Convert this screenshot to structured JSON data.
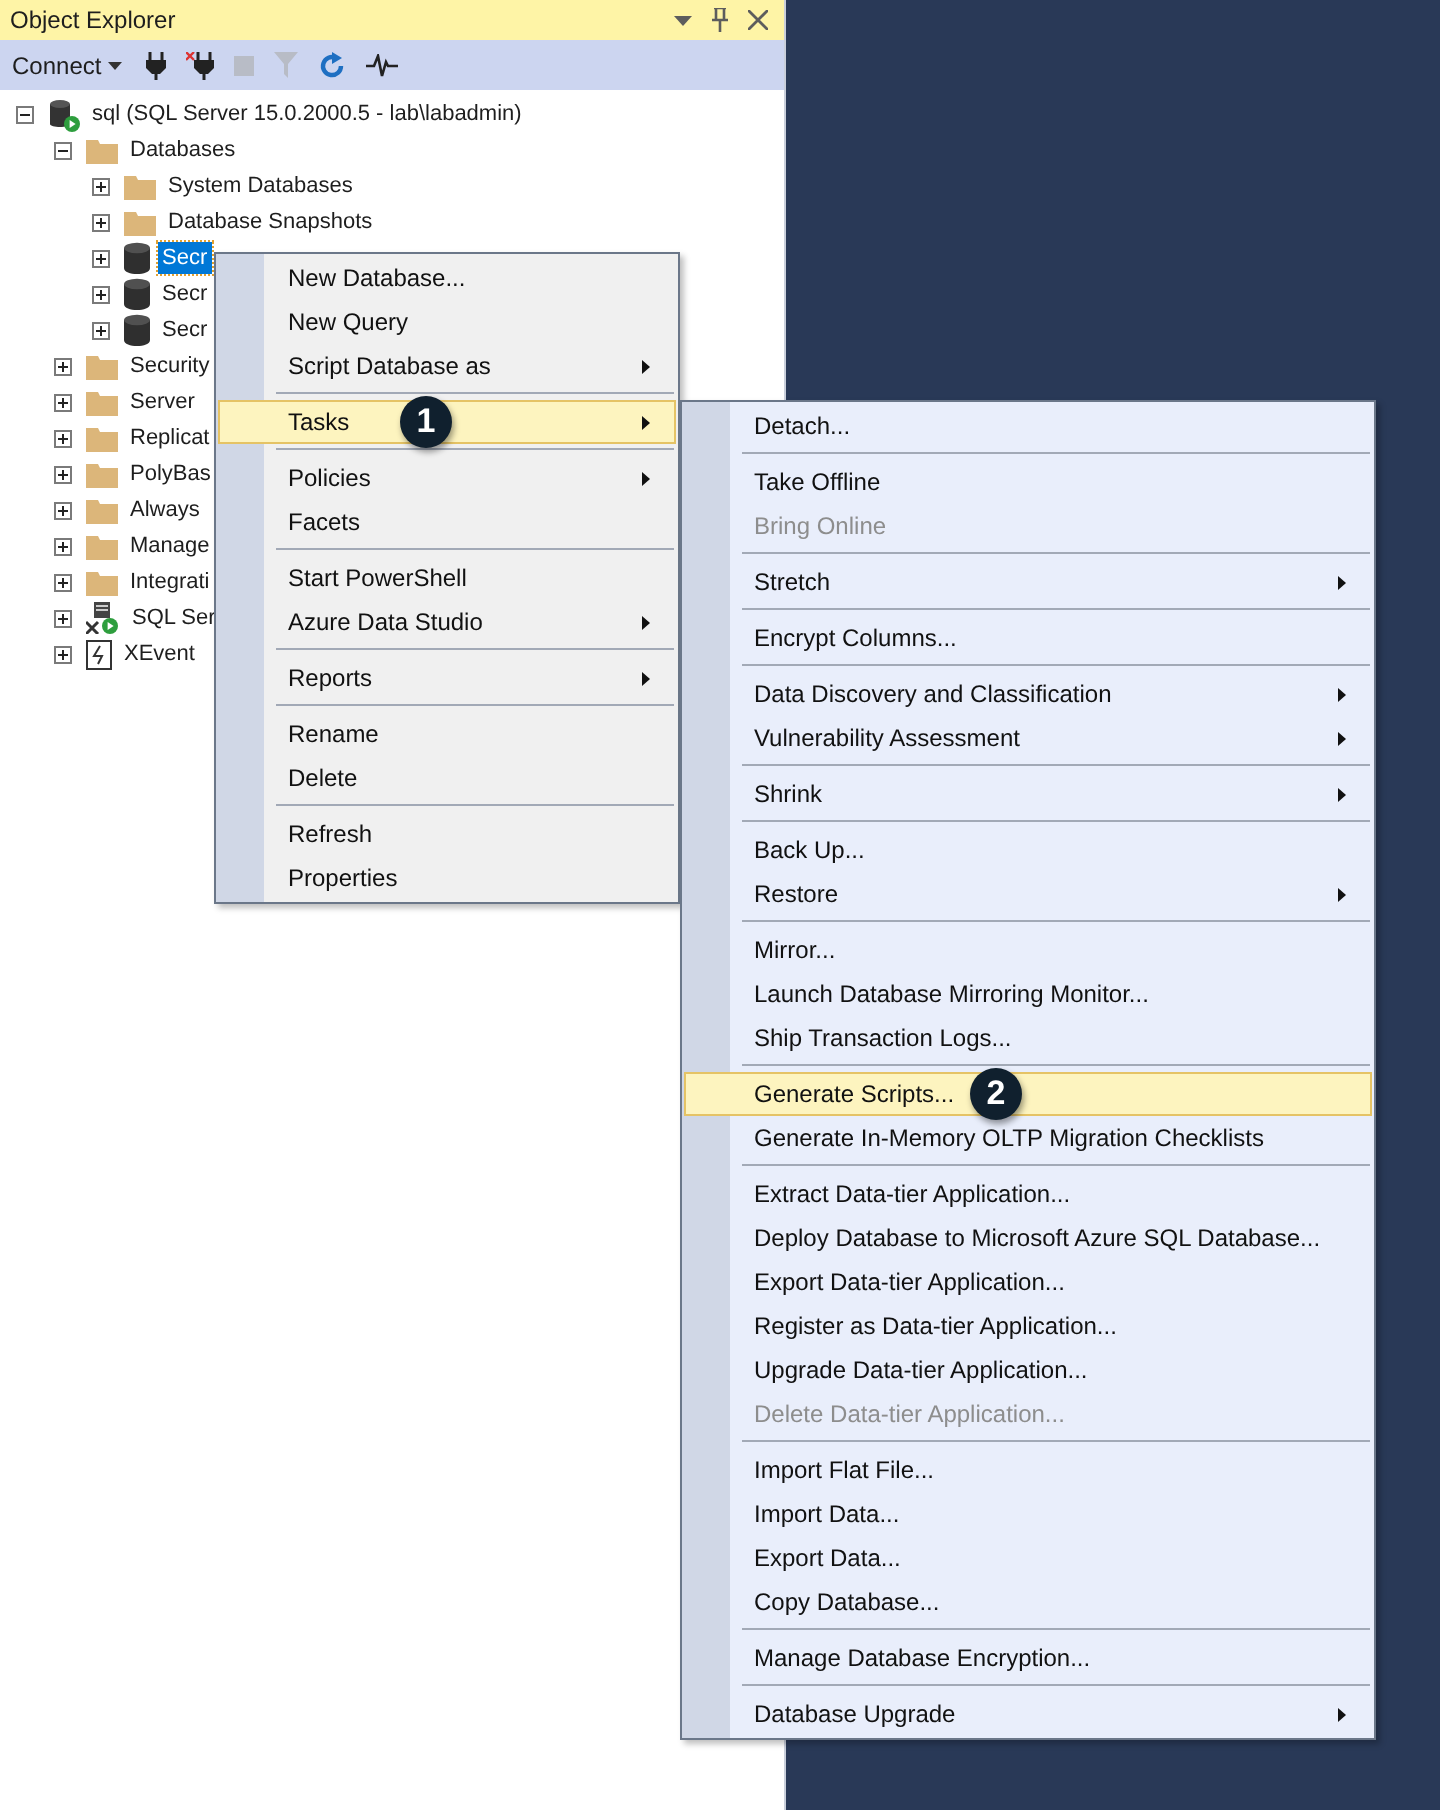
{
  "panel": {
    "title": "Object Explorer"
  },
  "toolbar": {
    "connect_label": "Connect"
  },
  "tree": [
    {
      "label": "sql (SQL Server 15.0.2000.5 - lab\\labadmin)",
      "kind": "server",
      "expanded": true,
      "selected": false,
      "children": [
        {
          "label": "Databases",
          "kind": "folder",
          "expanded": true,
          "selected": false,
          "children": [
            {
              "label": "System Databases",
              "kind": "folder",
              "expanded": false,
              "selected": false
            },
            {
              "label": "Database Snapshots",
              "kind": "folder",
              "expanded": false,
              "selected": false
            },
            {
              "label": "Secr",
              "kind": "database",
              "expanded": false,
              "selected": true
            },
            {
              "label": "Secr",
              "kind": "database",
              "expanded": false,
              "selected": false
            },
            {
              "label": "Secr",
              "kind": "database",
              "expanded": false,
              "selected": false
            }
          ]
        },
        {
          "label": "Security",
          "kind": "folder",
          "expanded": false,
          "selected": false
        },
        {
          "label": "Server",
          "kind": "folder",
          "expanded": false,
          "selected": false
        },
        {
          "label": "Replicat",
          "kind": "folder",
          "expanded": false,
          "selected": false
        },
        {
          "label": "PolyBas",
          "kind": "folder",
          "expanded": false,
          "selected": false
        },
        {
          "label": "Always",
          "kind": "folder",
          "expanded": false,
          "selected": false
        },
        {
          "label": "Manage",
          "kind": "folder",
          "expanded": false,
          "selected": false
        },
        {
          "label": "Integrati",
          "kind": "folder",
          "expanded": false,
          "selected": false
        },
        {
          "label": "SQL Ser",
          "kind": "agent",
          "expanded": false,
          "selected": false
        },
        {
          "label": "XEvent",
          "kind": "xevent",
          "expanded": false,
          "selected": false
        }
      ]
    }
  ],
  "context_menu": {
    "sections": [
      {
        "items": [
          {
            "label": "New Database...",
            "selected": false,
            "disabled": false,
            "has_submenu": false
          },
          {
            "label": "New Query",
            "selected": false,
            "disabled": false,
            "has_submenu": false
          },
          {
            "label": "Script Database as",
            "selected": false,
            "disabled": false,
            "has_submenu": true
          }
        ]
      },
      {
        "items": [
          {
            "label": "Tasks",
            "selected": true,
            "disabled": false,
            "has_submenu": true,
            "badge": "1"
          }
        ]
      },
      {
        "items": [
          {
            "label": "Policies",
            "selected": false,
            "disabled": false,
            "has_submenu": true
          },
          {
            "label": "Facets",
            "selected": false,
            "disabled": false,
            "has_submenu": false
          }
        ]
      },
      {
        "items": [
          {
            "label": "Start PowerShell",
            "selected": false,
            "disabled": false,
            "has_submenu": false
          },
          {
            "label": "Azure Data Studio",
            "selected": false,
            "disabled": false,
            "has_submenu": true
          }
        ]
      },
      {
        "items": [
          {
            "label": "Reports",
            "selected": false,
            "disabled": false,
            "has_submenu": true
          }
        ]
      },
      {
        "items": [
          {
            "label": "Rename",
            "selected": false,
            "disabled": false,
            "has_submenu": false
          },
          {
            "label": "Delete",
            "selected": false,
            "disabled": false,
            "has_submenu": false
          }
        ]
      },
      {
        "items": [
          {
            "label": "Refresh",
            "selected": false,
            "disabled": false,
            "has_submenu": false
          },
          {
            "label": "Properties",
            "selected": false,
            "disabled": false,
            "has_submenu": false
          }
        ]
      }
    ]
  },
  "submenu": {
    "sections": [
      {
        "items": [
          {
            "label": "Detach...",
            "selected": false,
            "disabled": false,
            "has_submenu": false
          }
        ]
      },
      {
        "items": [
          {
            "label": "Take Offline",
            "selected": false,
            "disabled": false,
            "has_submenu": false
          },
          {
            "label": "Bring Online",
            "selected": false,
            "disabled": true,
            "has_submenu": false
          }
        ]
      },
      {
        "items": [
          {
            "label": "Stretch",
            "selected": false,
            "disabled": false,
            "has_submenu": true
          }
        ]
      },
      {
        "items": [
          {
            "label": "Encrypt Columns...",
            "selected": false,
            "disabled": false,
            "has_submenu": false
          }
        ]
      },
      {
        "items": [
          {
            "label": "Data Discovery and Classification",
            "selected": false,
            "disabled": false,
            "has_submenu": true
          },
          {
            "label": "Vulnerability Assessment",
            "selected": false,
            "disabled": false,
            "has_submenu": true
          }
        ]
      },
      {
        "items": [
          {
            "label": "Shrink",
            "selected": false,
            "disabled": false,
            "has_submenu": true
          }
        ]
      },
      {
        "items": [
          {
            "label": "Back Up...",
            "selected": false,
            "disabled": false,
            "has_submenu": false
          },
          {
            "label": "Restore",
            "selected": false,
            "disabled": false,
            "has_submenu": true
          }
        ]
      },
      {
        "items": [
          {
            "label": "Mirror...",
            "selected": false,
            "disabled": false,
            "has_submenu": false
          },
          {
            "label": "Launch Database Mirroring Monitor...",
            "selected": false,
            "disabled": false,
            "has_submenu": false
          },
          {
            "label": "Ship Transaction Logs...",
            "selected": false,
            "disabled": false,
            "has_submenu": false
          }
        ]
      },
      {
        "items": [
          {
            "label": "Generate Scripts...",
            "selected": true,
            "disabled": false,
            "has_submenu": false,
            "badge": "2"
          },
          {
            "label": "Generate In-Memory OLTP Migration Checklists",
            "selected": false,
            "disabled": false,
            "has_submenu": false
          }
        ]
      },
      {
        "items": [
          {
            "label": "Extract Data-tier Application...",
            "selected": false,
            "disabled": false,
            "has_submenu": false
          },
          {
            "label": "Deploy Database to Microsoft Azure SQL Database...",
            "selected": false,
            "disabled": false,
            "has_submenu": false
          },
          {
            "label": "Export Data-tier Application...",
            "selected": false,
            "disabled": false,
            "has_submenu": false
          },
          {
            "label": "Register as Data-tier Application...",
            "selected": false,
            "disabled": false,
            "has_submenu": false
          },
          {
            "label": "Upgrade Data-tier Application...",
            "selected": false,
            "disabled": false,
            "has_submenu": false
          },
          {
            "label": "Delete Data-tier Application...",
            "selected": false,
            "disabled": true,
            "has_submenu": false
          }
        ]
      },
      {
        "items": [
          {
            "label": "Import Flat File...",
            "selected": false,
            "disabled": false,
            "has_submenu": false
          },
          {
            "label": "Import Data...",
            "selected": false,
            "disabled": false,
            "has_submenu": false
          },
          {
            "label": "Export Data...",
            "selected": false,
            "disabled": false,
            "has_submenu": false
          },
          {
            "label": "Copy Database...",
            "selected": false,
            "disabled": false,
            "has_submenu": false
          }
        ]
      },
      {
        "items": [
          {
            "label": "Manage Database Encryption...",
            "selected": false,
            "disabled": false,
            "has_submenu": false
          }
        ]
      },
      {
        "items": [
          {
            "label": "Database Upgrade",
            "selected": false,
            "disabled": false,
            "has_submenu": true
          }
        ]
      }
    ]
  }
}
